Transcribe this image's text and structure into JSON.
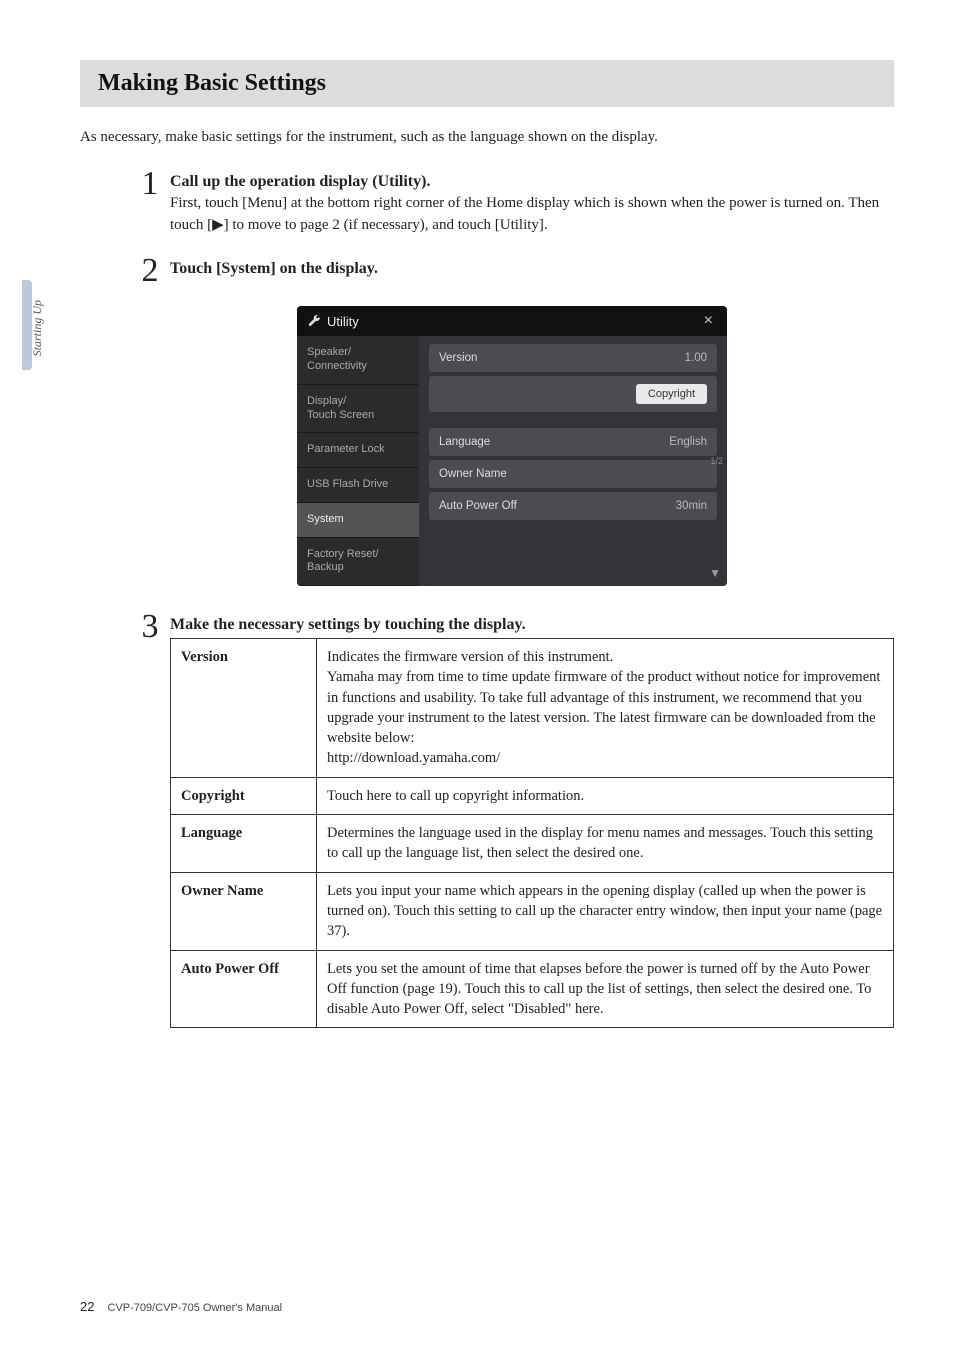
{
  "sidetab": "Starting Up",
  "heading": "Making Basic Settings",
  "intro": "As necessary, make basic settings for the instrument, such as the language shown on the display.",
  "steps": [
    {
      "num": "1",
      "title": "Call up the operation display (Utility).",
      "text": "First, touch [Menu] at the bottom right corner of the Home display which is shown when the power is turned on. Then touch [▶] to move to page 2 (if necessary), and touch [Utility]."
    },
    {
      "num": "2",
      "title": "Touch [System] on the display.",
      "text": ""
    },
    {
      "num": "3",
      "title": "Make the necessary settings by touching the display.",
      "text": ""
    }
  ],
  "utility": {
    "title": "Utility",
    "close": "×",
    "sidebar": [
      "Speaker/\nConnectivity",
      "Display/\nTouch Screen",
      "Parameter Lock",
      "USB Flash Drive",
      "System",
      "Factory Reset/\nBackup"
    ],
    "selected_index": 4,
    "rows": {
      "version_label": "Version",
      "version_value": "1.00",
      "copyright_btn": "Copyright",
      "language_label": "Language",
      "language_value": "English",
      "owner_label": "Owner Name",
      "owner_value": "",
      "apo_label": "Auto Power Off",
      "apo_value": "30min"
    },
    "page_indicator": "1/2"
  },
  "table": [
    {
      "key": "Version",
      "val": "Indicates the firmware version of this instrument.\nYamaha may from time to time update firmware of the product without notice for improvement in functions and usability. To take full advantage of this instrument, we recommend that you upgrade your instrument to the latest version. The latest firmware can be downloaded from the website below:\nhttp://download.yamaha.com/"
    },
    {
      "key": "Copyright",
      "val": "Touch here to call up copyright information."
    },
    {
      "key": "Language",
      "val": "Determines the language used in the display for menu names and messages. Touch this setting to call up the language list, then select the desired one."
    },
    {
      "key": "Owner Name",
      "val": "Lets you input your name which appears in the opening display (called up when the power is turned on). Touch this setting to call up the character entry window, then input your name (page 37)."
    },
    {
      "key": "Auto Power Off",
      "val": "Lets you set the amount of time that elapses before the power is turned off by the Auto Power Off function (page 19). Touch this to call up the list of settings, then select the desired one. To disable Auto Power Off, select \"Disabled\" here."
    }
  ],
  "footer": {
    "page": "22",
    "text": "CVP-709/CVP-705 Owner's Manual"
  }
}
